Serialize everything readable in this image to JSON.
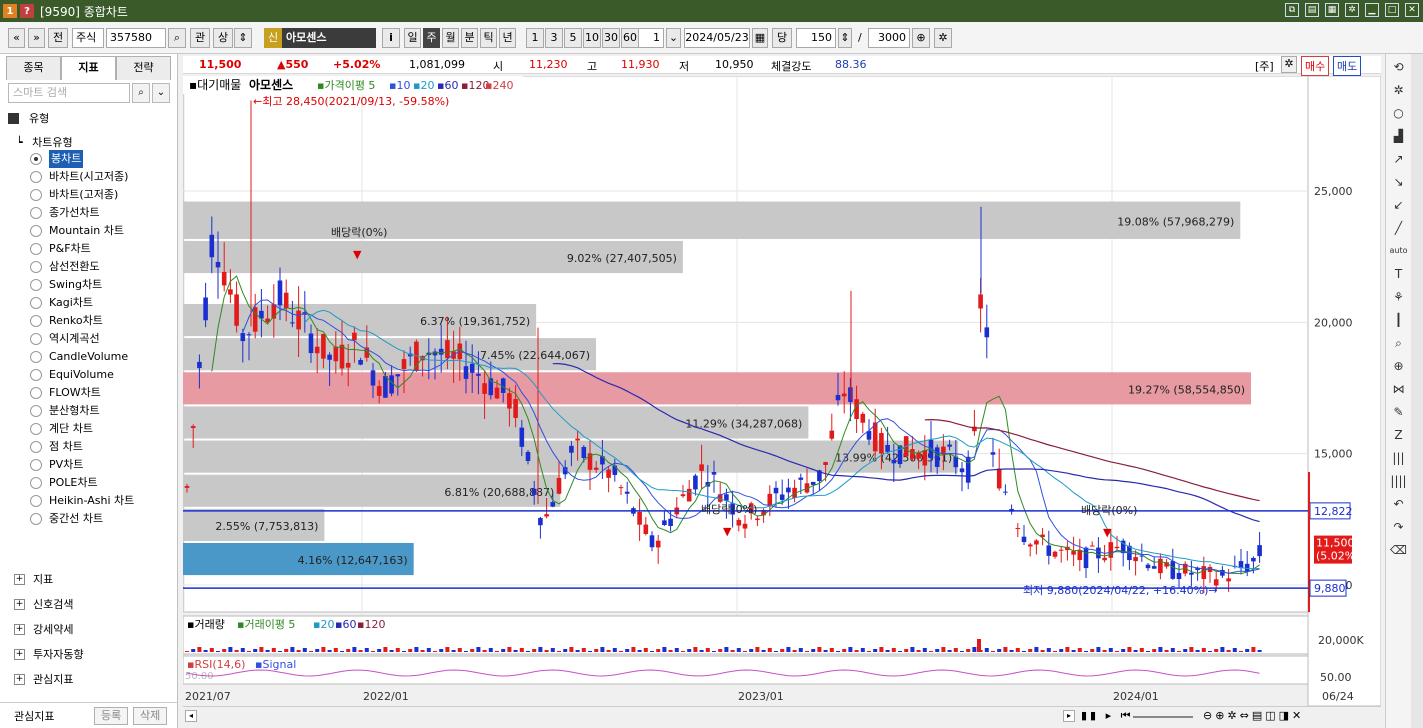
{
  "window": {
    "badge1": "1",
    "badge2": "?",
    "title": "[9590] 종합차트"
  },
  "toolbar": {
    "nav_prev": "«",
    "nav_down": "»",
    "btn_jeon": "전",
    "market": "주식",
    "code": "357580",
    "btn_gwan": "관",
    "btn_sang": "상",
    "shin_badge": "신",
    "stock_name": "아모센스",
    "info_btn": "i",
    "periods": [
      "일",
      "주",
      "월",
      "분",
      "틱",
      "년"
    ],
    "active_period": "주",
    "intervals": [
      "1",
      "3",
      "5",
      "10",
      "30",
      "60"
    ],
    "interval_value": "1",
    "date": "2024/05/23",
    "dang": "당",
    "count": "150",
    "slash": "/",
    "total": "3000"
  },
  "left_tabs": [
    "종목",
    "지표",
    "전략"
  ],
  "active_left_tab": "지표",
  "search_placeholder": "스마트 검색",
  "tree_header": "유형",
  "tree_sub": "차트유형",
  "chart_types": [
    "봉차트",
    "바차트(시고저종)",
    "바차트(고저종)",
    "종가선차트",
    "Mountain 차트",
    "P&F차트",
    "삼선전환도",
    "Swing차트",
    "Kagi차트",
    "Renko차트",
    "역시계곡선",
    "CandleVolume",
    "EquiVolume",
    "FLOW차트",
    "분산형차트",
    "계단 차트",
    "점 차트",
    "PV차트",
    "POLE차트",
    "Heikin-Ashi 차트",
    "중간선 차트"
  ],
  "selected_chart_type": "봉차트",
  "bottom_groups": [
    "지표",
    "신호검색",
    "강세약세",
    "투자자동향",
    "관심지표"
  ],
  "bottom_left": {
    "label": "관심지표",
    "register": "등록",
    "delete": "삭제"
  },
  "quote": {
    "price": "11,500",
    "change": "▲550",
    "pct": "+5.02%",
    "volume": "1,081,099",
    "open_label": "시",
    "open": "11,230",
    "high_label": "고",
    "high": "11,930",
    "low_label": "저",
    "low": "10,950",
    "strength_label": "체결강도",
    "strength": "88.36",
    "jusik": "[주]",
    "buy": "매수",
    "sell": "매도"
  },
  "chart_data": {
    "type": "candlestick",
    "legend": {
      "title": "대기매물",
      "name": "아모센스",
      "ma_label": "가격이평 5",
      "ma": [
        "5",
        "10",
        "20",
        "60",
        "120",
        "240"
      ]
    },
    "y_ticks": [
      "25,000",
      "20,000",
      "15,000",
      "10,000"
    ],
    "y_range": [
      9200,
      29000
    ],
    "x_ticks": [
      "2021/07",
      "2022/01",
      "2023/01",
      "2024/01"
    ],
    "right_end_label": "06/24",
    "high_note": "←최고 28,450(2021/09/13, -59.58%)",
    "low_note": "최저 9,880(2024/04/22, +16.40%)→",
    "dividend_label": "배당락(0%)",
    "price_labels": [
      "12,822",
      "11,500",
      "(5.02%)",
      "9,880"
    ],
    "volume_profile": [
      {
        "low": 23100,
        "high": 24600,
        "pct": "19.08% (57,968,279)",
        "value": 57968279
      },
      {
        "low": 21800,
        "high": 23100,
        "pct": "9.02% (27,407,505)",
        "value": 27407505
      },
      {
        "low": 19400,
        "high": 20700,
        "pct": "6.37% (19,361,752)",
        "value": 19361752
      },
      {
        "low": 18100,
        "high": 19400,
        "pct": "7.45% (22,644,067)",
        "value": 22644067
      },
      {
        "low": 16800,
        "high": 18100,
        "pct": "19.27% (58,554,850)",
        "value": 58554850
      },
      {
        "low": 15500,
        "high": 16800,
        "pct": "11.29% (34,287,068)",
        "value": 34287068
      },
      {
        "low": 14200,
        "high": 15500,
        "pct": "13.99% (42,500,561)",
        "value": 42500561
      },
      {
        "low": 12900,
        "high": 14200,
        "pct": "6.81% (20,688,887)",
        "value": 20688887
      },
      {
        "low": 11600,
        "high": 12900,
        "pct": "2.55% (7,753,813)",
        "value": 7753813
      },
      {
        "low": 10300,
        "high": 11600,
        "pct": "4.16% (12,647,163)",
        "value": 12647163
      }
    ],
    "volume_title": "거래량",
    "volume_ma_label": "거래이평 5",
    "volume_ma": [
      "20",
      "60",
      "120"
    ],
    "volume_tick": "20,000K",
    "rsi_label": "RSI(14,6)",
    "rsi_signal": "Signal",
    "rsi_ticks": [
      "50.00",
      "50.00"
    ]
  }
}
